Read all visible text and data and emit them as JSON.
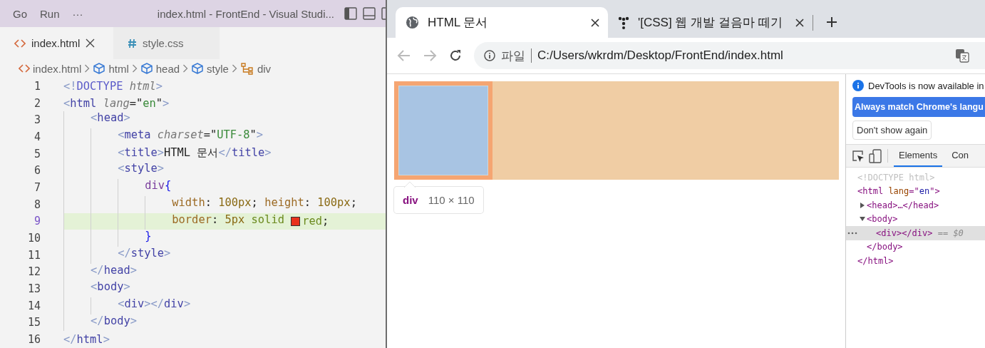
{
  "editor": {
    "menu": [
      "Go",
      "Run",
      "···"
    ],
    "title": "index.html - FrontEnd - Visual Studi...",
    "tabs": [
      {
        "label": "index.html",
        "selected": true,
        "kind": "html"
      },
      {
        "label": "style.css",
        "selected": false,
        "kind": "css"
      }
    ],
    "breadcrumbs": [
      {
        "label": "index.html",
        "kind": "file"
      },
      {
        "label": "html",
        "kind": "element"
      },
      {
        "label": "head",
        "kind": "element"
      },
      {
        "label": "style",
        "kind": "element"
      },
      {
        "label": "div",
        "kind": "rule"
      }
    ],
    "lines": [
      {
        "number": "1",
        "current": false,
        "kind": "markup",
        "text": "<!DOCTYPE html>"
      },
      {
        "number": "2",
        "current": false,
        "kind": "markup",
        "text": "<html lang=\"en\">"
      },
      {
        "number": "3",
        "current": false,
        "kind": "markup",
        "text": "    <head>"
      },
      {
        "number": "4",
        "current": false,
        "kind": "markup",
        "text": "        <meta charset=\"UTF-8\">"
      },
      {
        "number": "5",
        "current": false,
        "kind": "markup",
        "text": "        <title>HTML 문서</title>"
      },
      {
        "number": "6",
        "current": false,
        "kind": "markup",
        "text": "        <style>"
      },
      {
        "number": "7",
        "current": false,
        "kind": "css",
        "text": "            div{"
      },
      {
        "number": "8",
        "current": false,
        "kind": "css",
        "text": "                width: 100px; height: 100px;"
      },
      {
        "number": "9",
        "current": true,
        "kind": "css",
        "text": "                border: 5px solid ",
        "color": "#e8321c",
        "after": "red;"
      },
      {
        "number": "10",
        "current": false,
        "kind": "css",
        "text": "            }"
      },
      {
        "number": "11",
        "current": false,
        "kind": "markup",
        "text": "        </style>"
      },
      {
        "number": "12",
        "current": false,
        "kind": "markup",
        "text": "    </head>"
      },
      {
        "number": "13",
        "current": false,
        "kind": "markup",
        "text": "    <body>"
      },
      {
        "number": "14",
        "current": false,
        "kind": "markup",
        "text": "        <div></div>"
      },
      {
        "number": "15",
        "current": false,
        "kind": "markup",
        "text": "    </body>"
      },
      {
        "number": "16",
        "current": false,
        "kind": "markup",
        "text": "</html>"
      }
    ]
  },
  "browser": {
    "tabs": [
      {
        "title": "HTML 문서",
        "selected": true,
        "kind": "globe"
      },
      {
        "title": "'[CSS] 웹 개발 걸음마 떼기",
        "selected": false,
        "kind": "dots"
      }
    ],
    "address": {
      "scheme": "파일",
      "url": "C:/Users/wkrdm/Desktop/FrontEnd/index.html"
    },
    "tooltip": {
      "tag": "div",
      "size": "110 × 110"
    }
  },
  "devtools": {
    "notice": "DevTools is now available in",
    "primary_button": "Always match Chrome's langu",
    "secondary_button": "Don't show again",
    "tabs": [
      {
        "label": "Elements",
        "selected": true
      },
      {
        "label": "Con",
        "selected": false
      }
    ],
    "doctype": "<!DOCTYPE html>",
    "tree": [
      {
        "open": "<html lang=\"en\">",
        "close": "</html>",
        "children": [
          {
            "open": "<head>…</head>",
            "expanded": false,
            "selected": false
          },
          {
            "open": "<body>",
            "close": "</body>",
            "expanded": true,
            "selected": false,
            "children": [
              {
                "open": "<div></div>",
                "selected": true,
                "marker": "== $0"
              }
            ]
          }
        ]
      }
    ]
  }
}
